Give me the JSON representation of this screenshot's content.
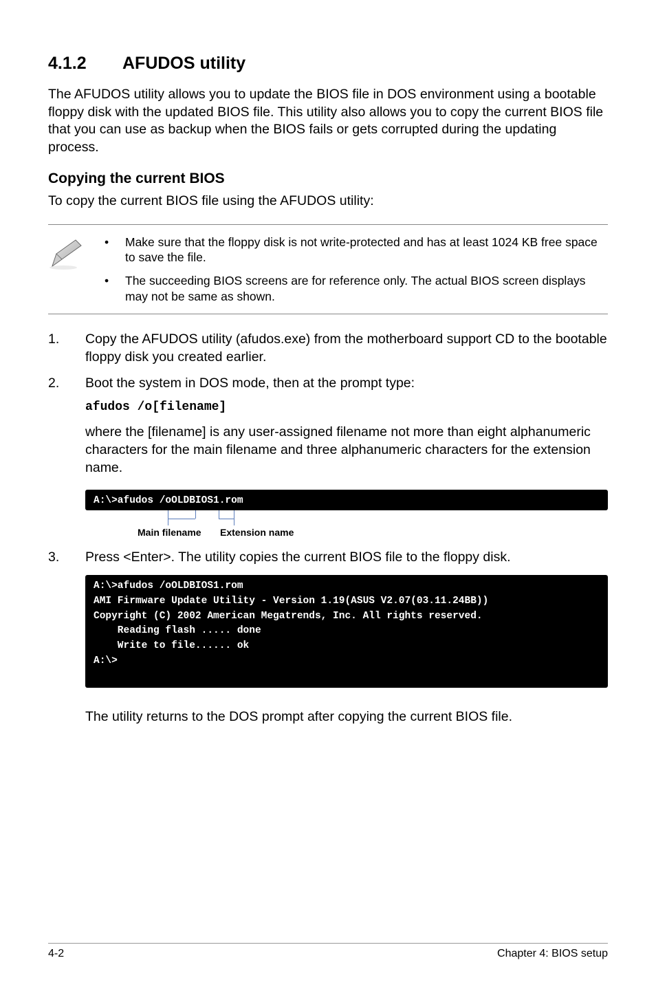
{
  "heading": {
    "number": "4.1.2",
    "title": "AFUDOS utility"
  },
  "intro": "The AFUDOS utility allows you to update the BIOS file in DOS environment using a bootable floppy disk with the updated BIOS file. This utility also allows you to copy the current BIOS file that you can use as backup when the BIOS fails or gets corrupted during the updating process.",
  "subheading": "Copying the current BIOS",
  "sub_intro": "To copy the current BIOS file using the AFUDOS utility:",
  "note": {
    "items": [
      "Make sure that the floppy disk is not write-protected and has at least 1024 KB free space to save the file.",
      "The succeeding BIOS screens are for reference only. The actual BIOS screen displays may not be same as shown."
    ]
  },
  "steps": {
    "s1": {
      "num": "1.",
      "text": "Copy the AFUDOS utility (afudos.exe) from the motherboard support CD to the bootable floppy disk you created earlier."
    },
    "s2": {
      "num": "2.",
      "text": "Boot the system in DOS mode, then at the prompt type:",
      "code": "afudos /o[filename]",
      "after": "where the [filename] is any user-assigned filename not more than eight alphanumeric characters for the main filename and three alphanumeric characters for the extension name."
    },
    "s3": {
      "num": "3.",
      "text": "Press <Enter>. The utility copies the current BIOS file to the floppy disk."
    }
  },
  "terminal1": "A:\\>afudos /oOLDBIOS1.rom",
  "annotations": {
    "main": "Main filename",
    "ext": "Extension name"
  },
  "terminal2": "A:\\>afudos /oOLDBIOS1.rom\nAMI Firmware Update Utility - Version 1.19(ASUS V2.07(03.11.24BB))\nCopyright (C) 2002 American Megatrends, Inc. All rights reserved.\n    Reading flash ..... done\n    Write to file...... ok\nA:\\>\n\n",
  "closing": "The utility returns to the DOS prompt after copying the current BIOS file.",
  "footer": {
    "left": "4-2",
    "right": "Chapter 4: BIOS setup"
  }
}
